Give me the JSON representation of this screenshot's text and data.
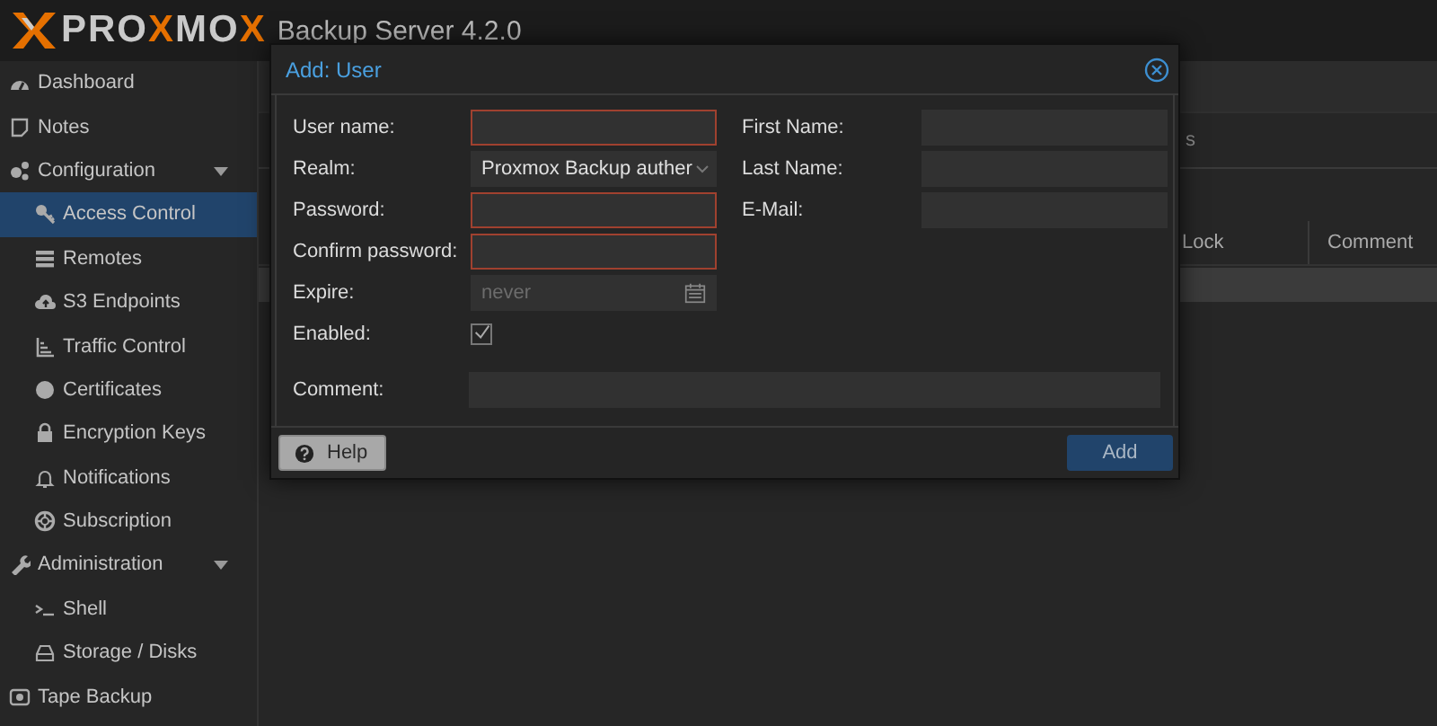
{
  "header": {
    "logo": [
      {
        "text": "PRO",
        "accent": false
      },
      {
        "text": "X",
        "accent": true
      },
      {
        "text": "MO",
        "accent": false
      },
      {
        "text": "X",
        "accent": true
      }
    ],
    "product": "Backup Server 4.2.0"
  },
  "sidebar": {
    "items": [
      {
        "label": "Dashboard",
        "selected": false
      },
      {
        "label": "Notes",
        "selected": false
      },
      {
        "label": "Configuration",
        "selected": false,
        "expanded": true,
        "children": [
          {
            "label": "Access Control",
            "selected": true
          },
          {
            "label": "Remotes",
            "selected": false
          },
          {
            "label": "S3 Endpoints",
            "selected": false
          },
          {
            "label": "Traffic Control",
            "selected": false
          },
          {
            "label": "Certificates",
            "selected": false
          },
          {
            "label": "Encryption Keys",
            "selected": false
          },
          {
            "label": "Notifications",
            "selected": false
          },
          {
            "label": "Subscription",
            "selected": false
          }
        ]
      },
      {
        "label": "Administration",
        "selected": false,
        "expanded": true,
        "children": [
          {
            "label": "Shell",
            "selected": false
          },
          {
            "label": "Storage / Disks",
            "selected": false
          }
        ]
      },
      {
        "label": "Tape Backup",
        "selected": false
      }
    ]
  },
  "main": {
    "tab": "s",
    "grid": {
      "columns": [
        "Lock",
        "Comment"
      ],
      "rows": [
        {
          "selected": true
        }
      ]
    }
  },
  "dialog": {
    "title": "Add: User",
    "left_fields": [
      {
        "label": "User name:",
        "kind": "text",
        "invalid": true
      },
      {
        "label": "Realm:",
        "kind": "combo",
        "value": "Proxmox Backup auther",
        "invalid": false
      },
      {
        "label": "Password:",
        "kind": "text",
        "invalid": true
      },
      {
        "label": "Confirm password:",
        "kind": "text",
        "invalid": true
      },
      {
        "label": "Expire:",
        "kind": "date",
        "placeholder": "never",
        "invalid": false
      },
      {
        "label": "Enabled:",
        "kind": "checkbox",
        "checked": true
      }
    ],
    "right_fields": [
      {
        "label": "First Name:",
        "kind": "text",
        "invalid": false
      },
      {
        "label": "Last Name:",
        "kind": "text",
        "invalid": false
      },
      {
        "label": "E-Mail:",
        "kind": "text",
        "invalid": false
      }
    ],
    "comment": {
      "label": "Comment:",
      "kind": "text",
      "invalid": false
    },
    "buttons": [
      {
        "label": "Help",
        "kind": "help"
      },
      {
        "label": "Add",
        "kind": "primary"
      }
    ]
  }
}
